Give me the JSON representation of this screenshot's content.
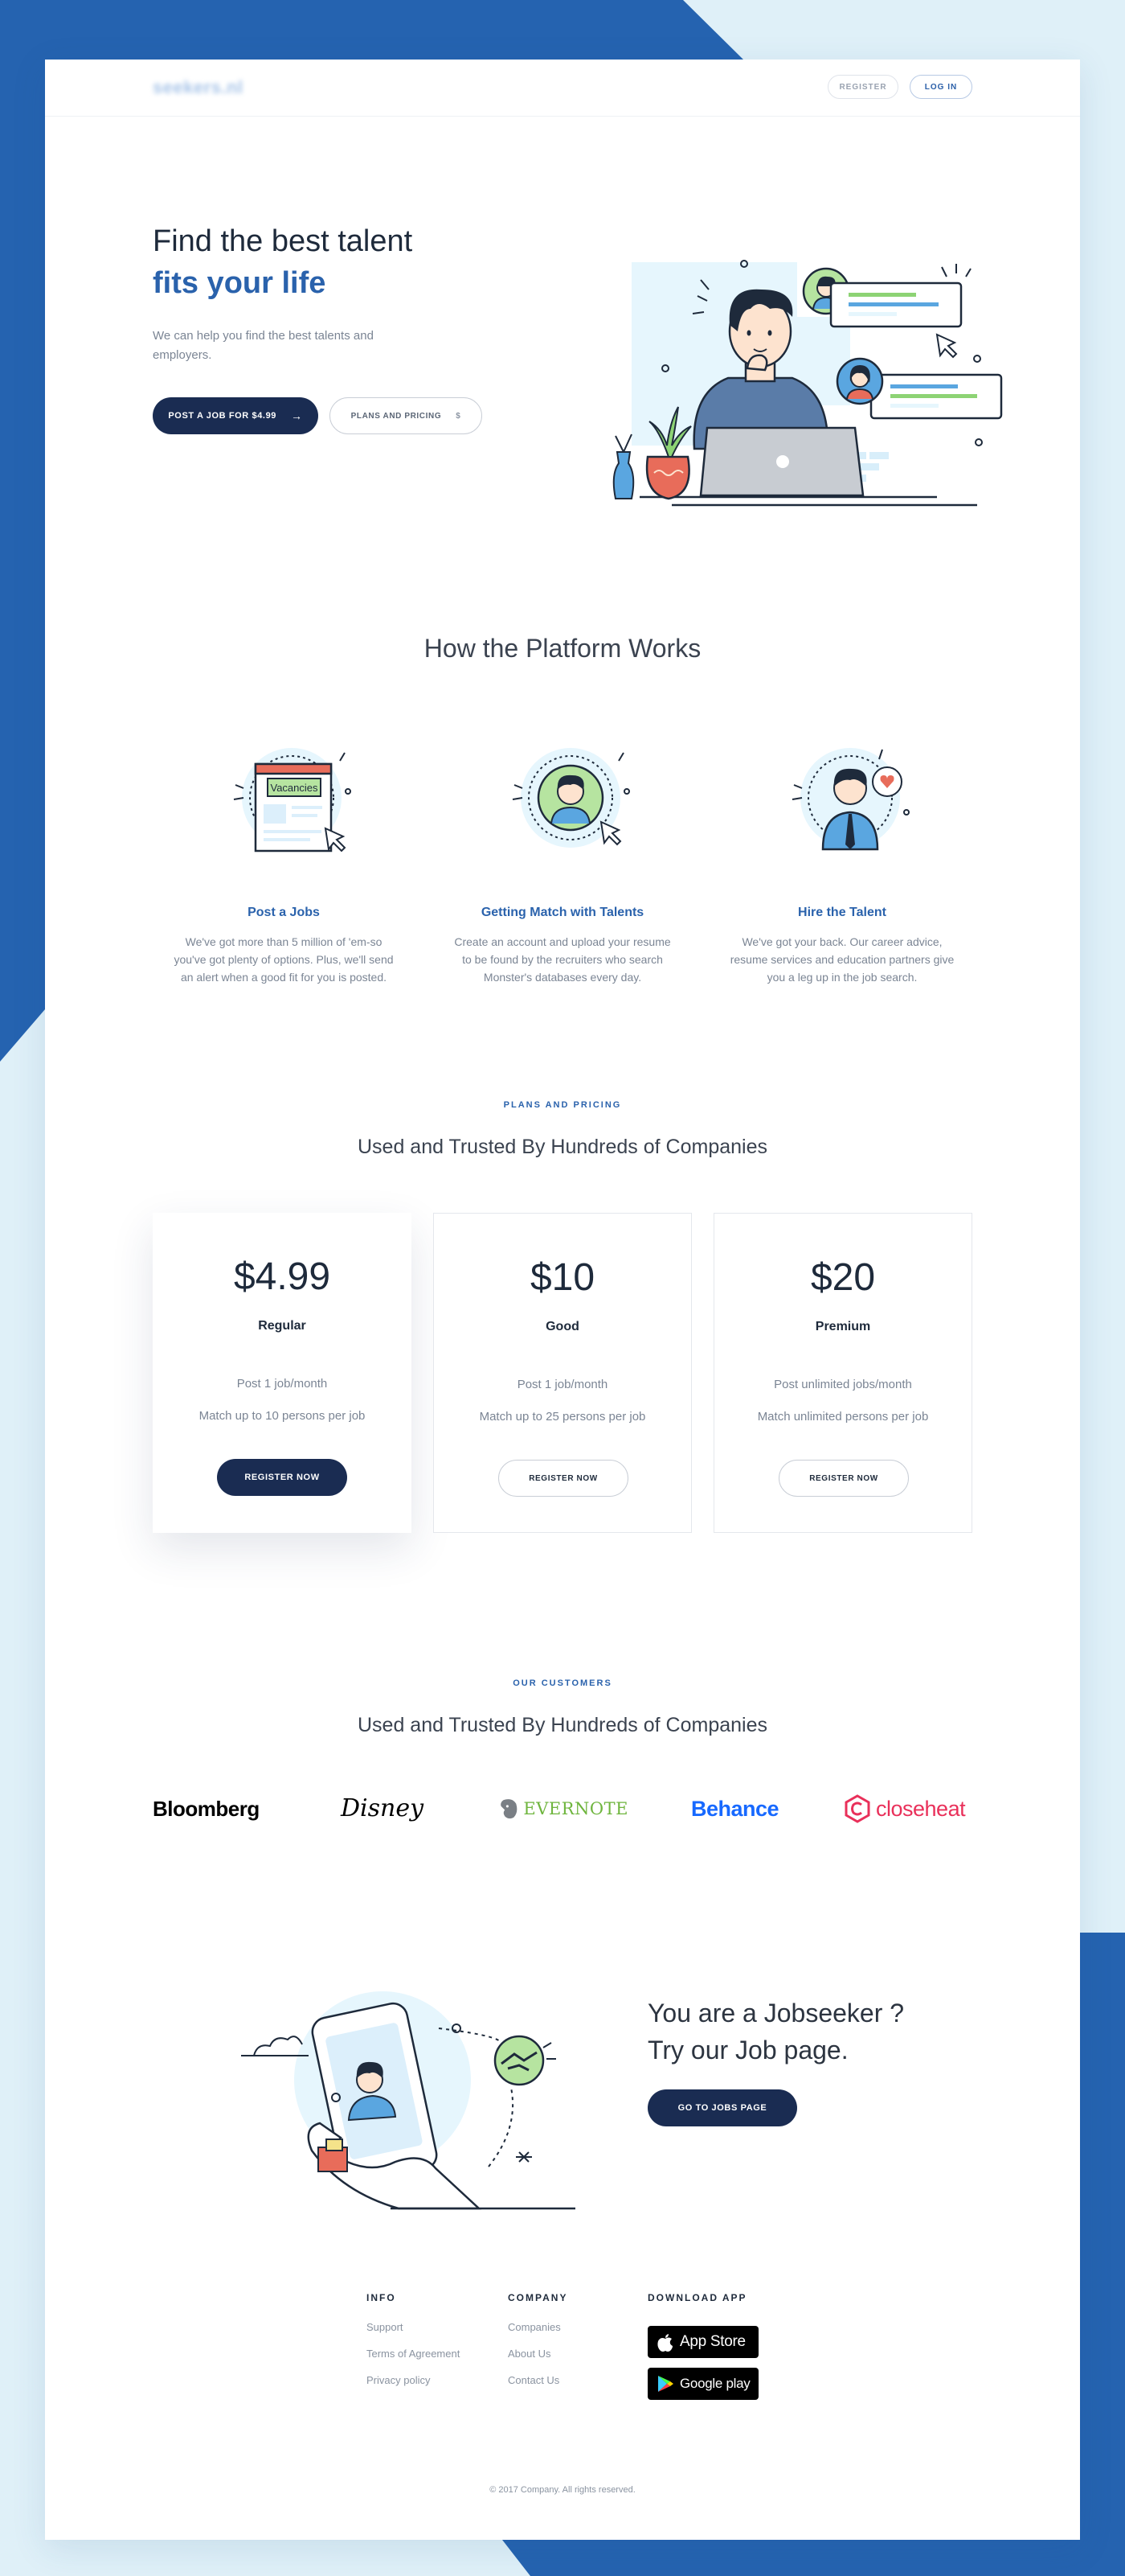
{
  "brand": {
    "logo_text": "seekers.nl"
  },
  "header": {
    "register_label": "REGISTER",
    "login_label": "LOG IN"
  },
  "hero": {
    "title_line1": "Find the best talent",
    "title_line2": "fits your life",
    "subtitle": "We can help you find the best talents and employers.",
    "primary_label": "POST A JOB FOR $4.99",
    "primary_icon": "arrow-right-icon",
    "secondary_label": "PLANS AND PRICING",
    "secondary_symbol": "$"
  },
  "how": {
    "title": "How the Platform Works",
    "steps": [
      {
        "title": "Post a Jobs",
        "icon": "vacancies-board-icon",
        "illus_label": "Vacancies",
        "desc": "We've got more than 5 million of 'em-so you've got plenty of options. Plus, we'll send an alert when a good fit for you is posted."
      },
      {
        "title": "Getting Match with Talents",
        "icon": "talent-avatar-icon",
        "desc": "Create an account and upload your resume to be found by the recruiters who search Monster's databases every day."
      },
      {
        "title": "Hire the Talent",
        "icon": "hire-heart-icon",
        "desc": "We've got your back. Our career advice, resume services and education partners give you a leg up in the job search."
      }
    ]
  },
  "pricing": {
    "eyebrow": "PLANS AND PRICING",
    "title": "Used and Trusted By Hundreds of Companies",
    "plans": [
      {
        "price": "$4.99",
        "name": "Regular",
        "feature1": "Post 1 job/month",
        "feature2": "Match up to 10 persons per job",
        "cta": "REGISTER NOW"
      },
      {
        "price": "$10",
        "name": "Good",
        "feature1": "Post 1 job/month",
        "feature2": "Match up to 25 persons per job",
        "cta": "REGISTER NOW"
      },
      {
        "price": "$20",
        "name": "Premium",
        "feature1": "Post unlimited jobs/month",
        "feature2": "Match unlimited persons per job",
        "cta": "REGISTER NOW"
      }
    ]
  },
  "customers": {
    "eyebrow": "OUR CUSTOMERS",
    "title": "Used and Trusted By Hundreds of Companies",
    "logos": [
      "Bloomberg",
      "Disney",
      "EVERNOTE",
      "Behance",
      "closeheat"
    ]
  },
  "jobseeker": {
    "title_line1": "You are a Jobseeker ?",
    "title_line2": "Try our Job page.",
    "cta": "GO TO JOBS PAGE"
  },
  "footer": {
    "info": {
      "heading": "INFO",
      "links": [
        "Support",
        "Terms of Agreement",
        "Privacy policy"
      ]
    },
    "company": {
      "heading": "COMPANY",
      "links": [
        "Companies",
        "About Us",
        "Contact Us"
      ]
    },
    "download": {
      "heading": "DOWNLOAD APP",
      "app_store": "App Store",
      "google_play": "Google play"
    },
    "copyright": "© 2017 Company. All rights reserved."
  },
  "colors": {
    "navy": "#1a2c52",
    "blue": "#2a62ac",
    "accent_bg": "#2563b0",
    "light_bg": "#dff0f8",
    "green": "#8dd374",
    "coral": "#e86c5a"
  }
}
